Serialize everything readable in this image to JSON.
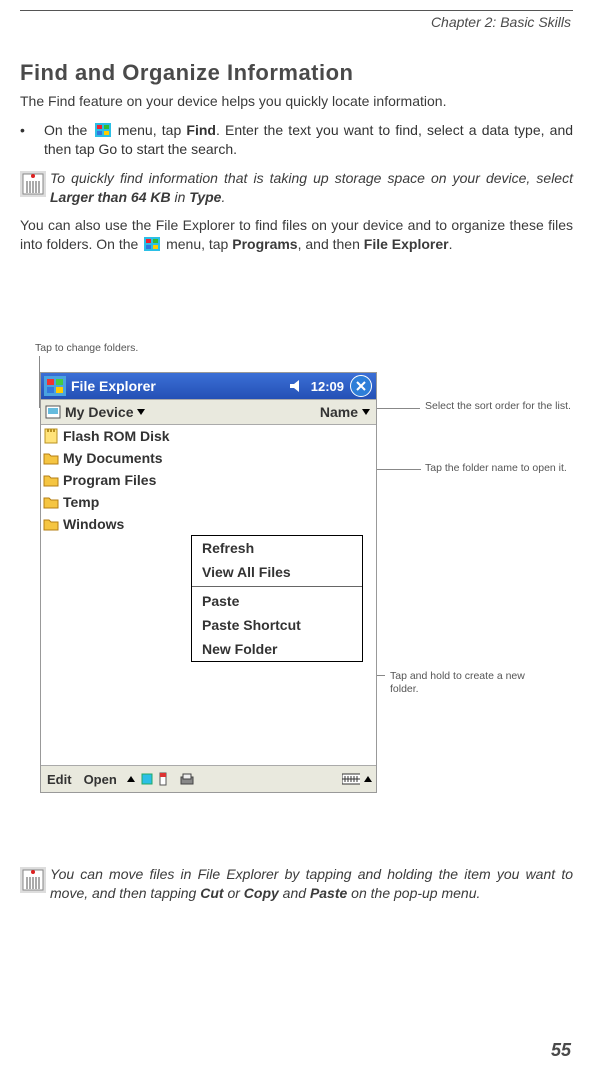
{
  "chapter": "Chapter 2: Basic Skills",
  "heading": "Find and Organize Information",
  "intro": "The Find feature on your device helps you quickly locate information.",
  "bullet_part1": "On the ",
  "bullet_find": "Find",
  "bullet_part2": ". Enter the text you want to find, select a data type, and then tap  Go  to start the search.",
  "bullet_menu_word": " menu, tap ",
  "note1_part1": "To quickly find information that is taking up storage space on your device, select  ",
  "note1_b1": "Larger than 64 KB",
  "note1_part2": "  in  ",
  "note1_b2": "Type",
  "note1_part3": ".",
  "para2_a": "You can also use the File Explorer to find files on your device and to orga­nize these files into folders. On  the ",
  "para2_b": " menu, tap ",
  "para2_bold1": "Programs",
  "para2_c": ", and then ",
  "para2_bold2": "File Explorer",
  "para2_d": ".",
  "callout_top": "Tap to change folders.",
  "callout_sort": "Select the sort order for the list.",
  "callout_open": "Tap the folder name to open it.",
  "callout_newfolder": "Tap and hold to create a new folder.",
  "pda": {
    "title": "File Explorer",
    "time": "12:09",
    "location": "My Device",
    "sort": "Name",
    "rows": [
      "Flash ROM Disk",
      "My Documents",
      "Program Files",
      "Temp",
      "Windows"
    ],
    "menu": {
      "refresh": "Refresh",
      "viewall": "View All Files",
      "paste": "Paste",
      "pasteshortcut": "Paste Shortcut",
      "newfolder": "New Folder"
    },
    "bottom_edit": "Edit",
    "bottom_open": "Open"
  },
  "note2_a": "You can move files in File Explorer by tapping and holding the item you want to move, and then tapping  ",
  "note2_b1": "Cut",
  "note2_b": "  or  ",
  "note2_b2": "Copy",
  "note2_c": "  and  ",
  "note2_b3": "Paste",
  "note2_d": "  on the pop-up menu.",
  "page_number": "55"
}
